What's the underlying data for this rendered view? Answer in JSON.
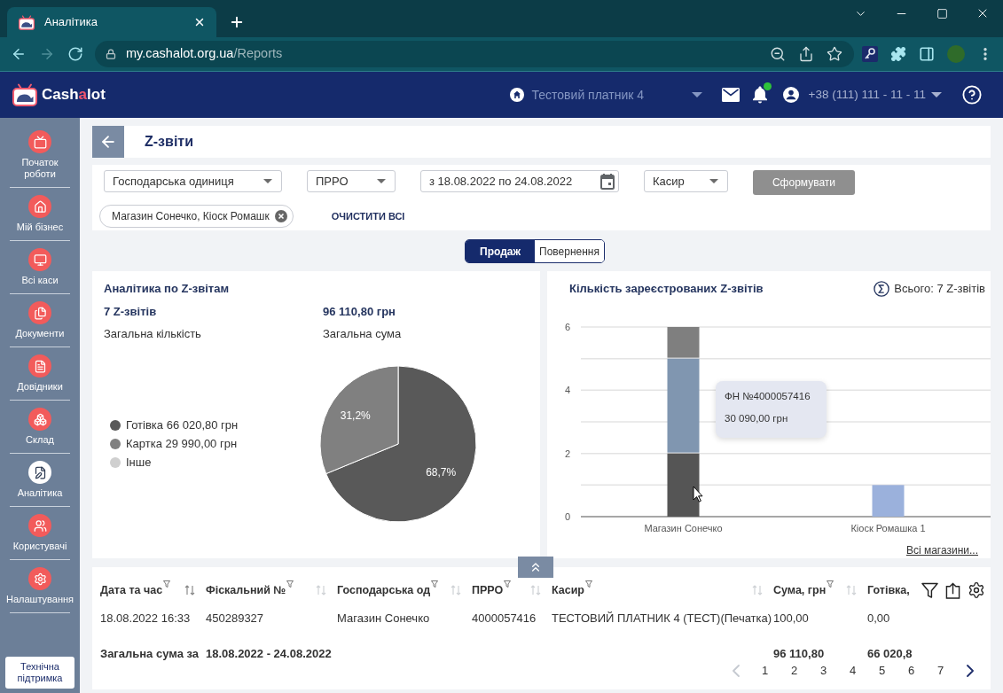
{
  "browser": {
    "tab_title": "Аналітика",
    "url_host": "my.cashalot.org.ua",
    "url_path": "/Reports",
    "nav_buttons": [
      {
        "kind": "back",
        "disabled": false
      },
      {
        "kind": "forward",
        "disabled": true
      },
      {
        "kind": "reload",
        "disabled": false
      }
    ]
  },
  "header": {
    "logo": [
      {
        "text": "Cash",
        "accent": false
      },
      {
        "text": "a",
        "accent": true
      },
      {
        "text": "lot",
        "accent": false
      }
    ],
    "payer": "Тестовий платник 4",
    "new_notifications": true,
    "phone": "+38 (111) 111 - 11 - 11"
  },
  "sidebar": {
    "items": [
      {
        "label": "Початок роботи",
        "selected": false
      },
      {
        "label": "Мій бізнес",
        "selected": false
      },
      {
        "label": "Всі каси",
        "selected": false
      },
      {
        "label": "Документи",
        "selected": false
      },
      {
        "label": "Довідники",
        "selected": false
      },
      {
        "label": "Склад",
        "selected": false
      },
      {
        "label": "Аналітика",
        "selected": true
      },
      {
        "label": "Користувачі",
        "selected": false
      },
      {
        "label": "Налаштування",
        "selected": false
      }
    ],
    "support_button": "Технічна підтримка"
  },
  "page": {
    "title": "Z-звіти"
  },
  "filters": {
    "fields": [
      {
        "kind": "dropdown",
        "label": "Господарська одиниця"
      },
      {
        "kind": "dropdown",
        "label": "ПРРО"
      },
      {
        "kind": "date",
        "label": "з 18.08.2022 по 24.08.2022"
      },
      {
        "kind": "dropdown",
        "label": "Касир"
      }
    ],
    "submit": {
      "label": "Сформувати",
      "disabled": true
    },
    "chips": [
      "Магазин Сонечко, Кіоск Ромашк"
    ],
    "clear_all": "ОЧИСТИТИ ВСІ"
  },
  "mode_tabs": [
    {
      "label": "Продаж",
      "selected": true
    },
    {
      "label": "Повернення",
      "selected": false
    }
  ],
  "summary_card": {
    "title": "Аналітика по Z-звітам",
    "stats": [
      {
        "value": "7 Z-звітів",
        "caption": "Загальна кількість"
      },
      {
        "value": "96 110,80 грн",
        "caption": "Загальна сума"
      }
    ],
    "chart_data": {
      "type": "pie",
      "categories": [
        "Готівка 66 020,80 грн",
        "Картка 29 990,00 грн"
      ],
      "values": [
        68.7,
        31.2
      ],
      "colors": [
        "#595959",
        "#808080"
      ],
      "value_labels": [
        "68,7%",
        "31,2%"
      ],
      "legend": "left"
    },
    "legend_extra": [
      {
        "label": "Інше",
        "color": "#cfcfcf"
      }
    ]
  },
  "count_card": {
    "title": "Кількість зареєстрованих Z-звітів",
    "total": "Всього: 7 Z-звітів",
    "chart_data": {
      "type": "bar",
      "categories": [
        "Магазин Сонечко",
        "Кіоск Ромашка 1"
      ],
      "series": [
        {
          "color": "#555555",
          "values": [
            2,
            0
          ]
        },
        {
          "color": "#8096b0",
          "values": [
            3,
            0
          ]
        },
        {
          "color": "#7f7f7f",
          "values": [
            1,
            0
          ]
        },
        {
          "color": "#9bb1dc",
          "values": [
            0,
            1
          ]
        }
      ],
      "stacked": true,
      "ylim": [
        0,
        6
      ],
      "yticks": [
        0,
        2,
        4,
        6
      ]
    },
    "tooltip": {
      "title": "ФН №4000057416",
      "value": "30 090,00 грн"
    },
    "link": "Всі магазини..."
  },
  "table": {
    "columns": [
      {
        "label": "Дата та час",
        "sorted": true
      },
      {
        "label": "Фіскальний №",
        "sorted": false
      },
      {
        "label": "Господарська од",
        "sorted": false
      },
      {
        "label": "ПРРО",
        "sorted": false
      },
      {
        "label": "Касир",
        "sorted": false
      },
      {
        "label": "Сума, грн",
        "sorted": false
      },
      {
        "label": "Готівка,"
      }
    ],
    "rows": [
      {
        "cells": [
          "18.08.2022 16:33",
          "450289327",
          "Магазин Сонечко",
          "4000057416",
          "ТЕСТОВИЙ ПЛАТНИК 4 (ТЕСТ)(Печатка)",
          "100,00",
          "0,00"
        ]
      }
    ],
    "totals": {
      "label": "Загальна сума за",
      "period": "18.08.2022 - 24.08.2022",
      "sum": "96 110,80",
      "cash": "66 020,8"
    },
    "pagination": {
      "prev_disabled": true,
      "pages": [
        "1",
        "2",
        "3",
        "4",
        "5",
        "6",
        "7"
      ],
      "next_disabled": false
    }
  }
}
